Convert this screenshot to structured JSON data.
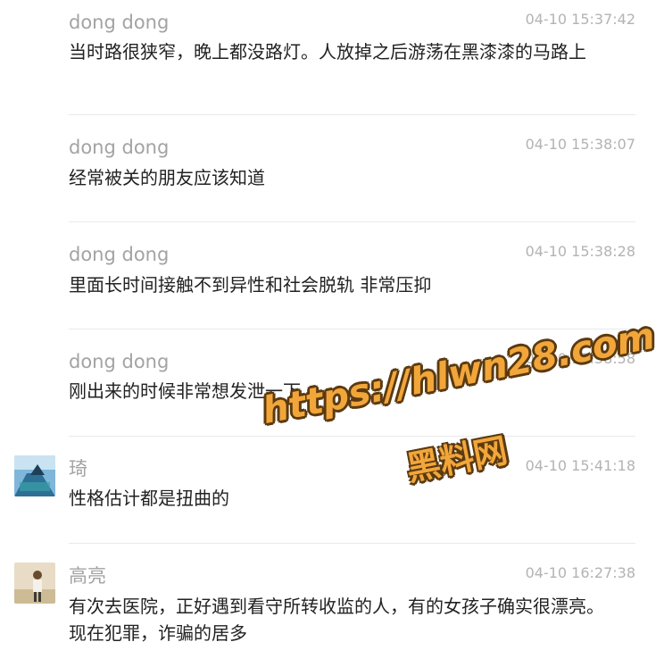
{
  "comments": [
    {
      "name": "dong dong",
      "time": "04-10 15:37:42",
      "text": "当时路很狭窄，晚上都没路灯。人放掉之后游荡在黑漆漆的马路上"
    },
    {
      "name": "dong dong",
      "time": "04-10 15:38:07",
      "text": "经常被关的朋友应该知道"
    },
    {
      "name": "dong dong",
      "time": "04-10 15:38:28",
      "text": "里面长时间接触不到异性和社会脱轨 非常压抑"
    },
    {
      "name": "dong dong",
      "time": "04-10 15:38:58",
      "text": "刚出来的时候非常想发泄一下"
    },
    {
      "name": "琦",
      "time": "04-10 15:41:18",
      "text": "性格估计都是扭曲的"
    },
    {
      "name": "高亮",
      "time": "04-10 16:27:38",
      "text": "有次去医院，正好遇到看守所转收监的人，有的女孩子确实很漂亮。现在犯罪，诈骗的居多"
    }
  ],
  "watermark": {
    "url": "https://hlwn28.com",
    "sub": "黑料网"
  },
  "colors": {
    "name": "#a3a3a3",
    "time": "#b3b3b3",
    "text": "#222222",
    "watermark": "#f2a63a"
  }
}
